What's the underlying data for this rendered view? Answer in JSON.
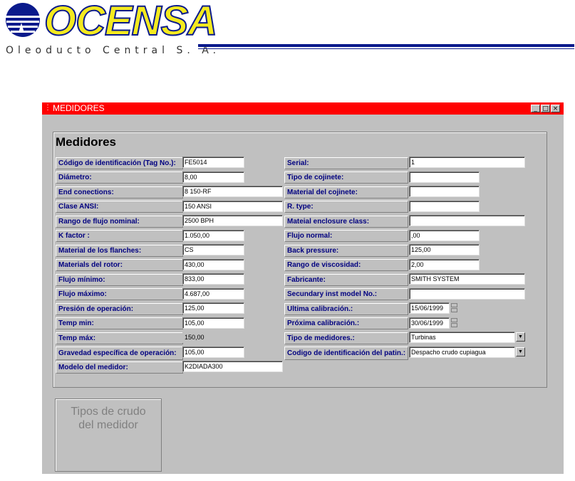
{
  "logo": {
    "name": "OCENSA",
    "subtitle": "Oleoducto Central S. A."
  },
  "window": {
    "title": "MEDIDORES",
    "buttons": [
      "_",
      "□",
      "×"
    ]
  },
  "form": {
    "heading": "Medidores",
    "left": [
      {
        "label": "Código de identificación (Tag No.):",
        "value": "FE5014"
      },
      {
        "label": "Diámetro:",
        "value": "8,00"
      },
      {
        "label": "End conections:",
        "value": "8 150-RF"
      },
      {
        "label": "Clase ANSI:",
        "value": "150 ANSI"
      },
      {
        "label": "Rango de flujo nominal:",
        "value": "2500 BPH"
      },
      {
        "label": "K factor :",
        "value": "1.050,00"
      },
      {
        "label": "Material de los flanches:",
        "value": "CS"
      },
      {
        "label": "Materials del rotor:",
        "value": "430,00"
      },
      {
        "label": "Flujo mínimo:",
        "value": "833,00"
      },
      {
        "label": "Flujo máximo:",
        "value": "4.687,00"
      },
      {
        "label": "Presión de operación:",
        "value": "125,00"
      },
      {
        "label": "Temp min:",
        "value": "105,00"
      },
      {
        "label": "Temp máx:",
        "value": "150,00"
      },
      {
        "label": "Gravedad específica de operación:",
        "value": "105,00"
      },
      {
        "label": "Modelo del medidor:",
        "value": "K2DIADA300"
      }
    ],
    "right": [
      {
        "label": "Serial:",
        "value": "1"
      },
      {
        "label": "Tipo de cojinete:",
        "value": ""
      },
      {
        "label": "Material del cojinete:",
        "value": ""
      },
      {
        "label": "R. type:",
        "value": ""
      },
      {
        "label": "Mateial enclosure class:",
        "value": ""
      },
      {
        "label": "Flujo normal:",
        "value": ",00"
      },
      {
        "label": "Back pressure:",
        "value": "125,00"
      },
      {
        "label": "Rango de viscosidad:",
        "value": "2,00"
      },
      {
        "label": "Fabricante:",
        "value": "SMITH SYSTEM"
      },
      {
        "label": "Secundary inst model No.:",
        "value": ""
      },
      {
        "label": "Ultima calibración.:",
        "value": "15/06/1999"
      },
      {
        "label": "Próxima calibración.:",
        "value": "30/06/1999"
      },
      {
        "label": "Tipo de medidores.:",
        "value": "Turbinas"
      },
      {
        "label": "Codigo de identificación del patin.:",
        "value": "Despacho crudo cupiagua"
      }
    ]
  },
  "tipos_button": {
    "line1": "Tipos de crudo",
    "line2": "del medidor"
  }
}
